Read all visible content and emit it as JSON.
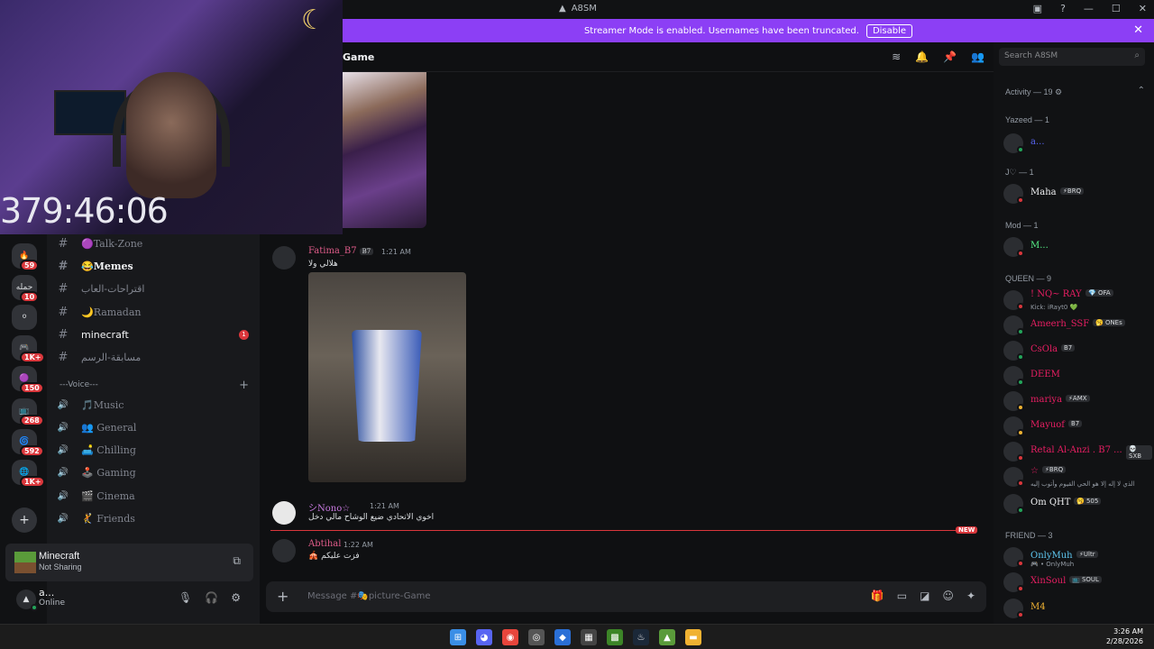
{
  "window": {
    "title": "A8SM"
  },
  "banner": {
    "text": "Streamer Mode is enabled. Usernames have been truncated.",
    "disable_label": "Disable"
  },
  "webcam": {
    "timer": "379:46:06"
  },
  "servers": [
    {
      "label": "🔥",
      "badge": "59"
    },
    {
      "label": "حمله",
      "badge": "10"
    },
    {
      "label": "⚪",
      "badge": ""
    },
    {
      "label": "🎮",
      "badge": "1K+"
    },
    {
      "label": "🟣",
      "badge": "150"
    },
    {
      "label": "📺",
      "badge": "268"
    },
    {
      "label": "🌀",
      "badge": "592"
    },
    {
      "label": "🌐",
      "badge": "1K+"
    }
  ],
  "channels": [
    {
      "label": "🟣Talk-Zone",
      "style": "normal"
    },
    {
      "label": "😂Memes",
      "style": "bold"
    },
    {
      "label": "اقتراحات-العاب",
      "style": "normal"
    },
    {
      "label": "🌙Ramadan",
      "style": "normal"
    },
    {
      "label": "minecraft",
      "style": "unread",
      "badge": "1"
    },
    {
      "label": "مسابقة-الرسم",
      "style": "normal"
    }
  ],
  "voice_category": "---Voice---",
  "voice_channels": [
    {
      "label": "🎵Music"
    },
    {
      "label": "👥 General"
    },
    {
      "label": "🛋️ Chilling"
    },
    {
      "label": "🕹️ Gaming"
    },
    {
      "label": "🎬 Cinema"
    },
    {
      "label": "🤾 Friends"
    }
  ],
  "activity": {
    "game": "Minecraft",
    "status": "Not Sharing"
  },
  "user": {
    "name": "a...",
    "status": "Online"
  },
  "header": {
    "channel": "Game"
  },
  "search": {
    "placeholder": "Search A8SM"
  },
  "messages": [
    {
      "author": "Fatima_B7",
      "tag": "B7",
      "time": "1:21 AM",
      "text": "هلالي ولا",
      "color": "#e05c8a"
    },
    {
      "author": "シNono☆",
      "tag": "",
      "time": "1:21 AM",
      "text": "اخوي الاتحادي ضيع الوشاح مالي دخل",
      "color": "#c678dd"
    },
    {
      "author": "Abtihal",
      "tag": "",
      "time": "1:22 AM",
      "text": "🎪 فزت عليكم",
      "color": "#e05c8a"
    }
  ],
  "new_label": "NEW",
  "composer": {
    "placeholder": "Message #🎭picture-Game"
  },
  "members": {
    "activity_header": "Activity — 19 ⚙",
    "sections": [
      {
        "title": "Yazeed — 1",
        "items": [
          {
            "name": "a...",
            "color": "#5865f2",
            "tag": "",
            "sub": "",
            "status": "#23a55a"
          }
        ]
      },
      {
        "title": "J♡ — 1",
        "items": [
          {
            "name": "Maha",
            "color": "#f2f3f5",
            "tag": "⚡BRQ",
            "sub": "",
            "status": "#da373c"
          }
        ]
      },
      {
        "title": "Mod — 1",
        "items": [
          {
            "name": "M...",
            "color": "#57f287",
            "tag": "",
            "sub": "",
            "status": "#da373c"
          }
        ]
      },
      {
        "title": "QUEEN — 9",
        "items": [
          {
            "name": "! NQ~ RAY",
            "color": "#e91e63",
            "tag": "💎 OFA",
            "sub": "Kick: iRayt0 💚",
            "status": "#da373c"
          },
          {
            "name": "Ameerh_SSF",
            "color": "#e91e63",
            "tag": "🥱 ONEs",
            "sub": "",
            "status": "#23a55a"
          },
          {
            "name": "CsOla",
            "color": "#e91e63",
            "tag": "B7",
            "sub": "",
            "status": "#23a55a"
          },
          {
            "name": "DEEM",
            "color": "#e91e63",
            "tag": "",
            "sub": "",
            "status": "#23a55a"
          },
          {
            "name": "mariya",
            "color": "#e91e63",
            "tag": "⚡AMX",
            "sub": "",
            "status": "#f0b232"
          },
          {
            "name": "Mayuof",
            "color": "#e91e63",
            "tag": "B7",
            "sub": "",
            "status": "#f0b232"
          },
          {
            "name": "Retal Al-Anzi . B7 ...",
            "color": "#e91e63",
            "tag": "💀 SXB",
            "sub": "",
            "status": "#da373c"
          },
          {
            "name": "☆",
            "color": "#e91e63",
            "tag": "⚡BRQ",
            "sub": "الذي لا إله إلا هو الحي القيوم وأتوب إليه",
            "status": "#da373c"
          },
          {
            "name": "Om QHT",
            "color": "#f2f3f5",
            "tag": "🥱 505",
            "sub": "",
            "status": "#23a55a"
          }
        ]
      },
      {
        "title": "FRIEND — 3",
        "items": [
          {
            "name": "OnlyMuh",
            "color": "#5ec7f0",
            "tag": "⚡Ultr",
            "sub": "🎮 • OnlyMuh",
            "status": "#da373c"
          },
          {
            "name": "XinSoul",
            "color": "#e91e63",
            "tag": "📺 SOUL",
            "sub": "",
            "status": "#da373c"
          },
          {
            "name": "M4",
            "color": "#f0b232",
            "tag": "",
            "sub": "",
            "status": "#da373c"
          }
        ]
      }
    ]
  },
  "clock": {
    "time": "3:26 AM",
    "date": "2/28/2026"
  },
  "accent": "#8c3ff5"
}
